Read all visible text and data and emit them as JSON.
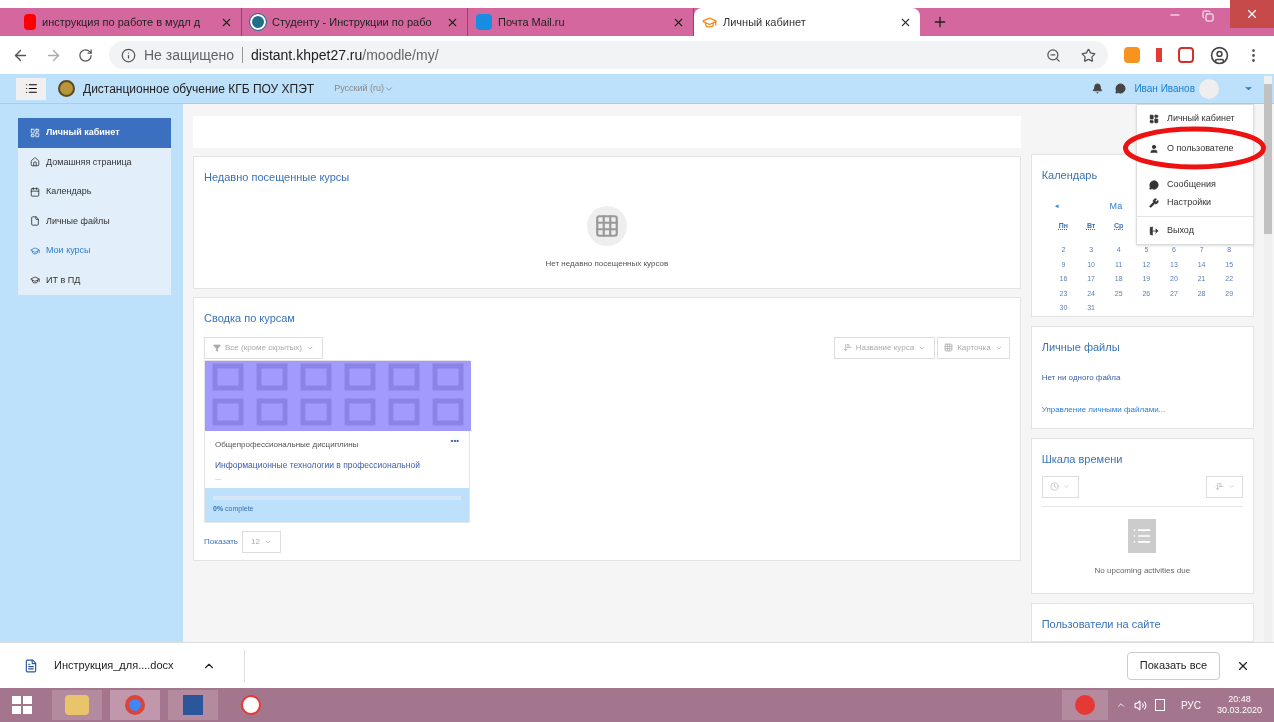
{
  "browser": {
    "tabs": [
      {
        "title": "инструкция по работе в мудл д",
        "selected": false
      },
      {
        "title": "Студенту - Инструкции по рабо",
        "selected": false
      },
      {
        "title": "Почта Mail.ru",
        "selected": false
      },
      {
        "title": "Личный кабинет",
        "selected": true
      }
    ],
    "security": "Не защищено",
    "url_host": "distant.khpet27.ru",
    "url_path": "/moodle/my/"
  },
  "navbar": {
    "site_name": "Дистанционное обучение КГБ ПОУ ХПЭТ",
    "language": "Русский (ru)",
    "user_name": "Иван Иванов"
  },
  "sidebar": {
    "items": [
      {
        "label": "Личный кабинет",
        "selected": true
      },
      {
        "label": "Домашняя страница",
        "selected": false
      },
      {
        "label": "Календарь",
        "selected": false
      },
      {
        "label": "Личные файлы",
        "selected": false
      },
      {
        "label": "Мои курсы",
        "selected": false
      },
      {
        "label": "ИТ в ПД",
        "selected": false
      }
    ]
  },
  "recent": {
    "title": "Недавно посещенные курсы",
    "empty": "Нет недавно посещенных курсов"
  },
  "overview": {
    "title": "Сводка по курсам",
    "filter": "Все (кроме скрытых)",
    "sort": "Название курса",
    "view": "Карточка",
    "course": {
      "category": "Общепрофессиональные дисциплины",
      "name": "Информационные технологии в профессиональной",
      "more": "...",
      "menu": "•••",
      "progress": "0%",
      "progress_suffix": " complete",
      "level": 0
    },
    "show_label": "Показать",
    "show_value": "12"
  },
  "calendar": {
    "title": "Календарь",
    "prev": "◄",
    "month": "Ма",
    "weekdays": [
      "Пн",
      "Вт",
      "Ср"
    ],
    "weeks": [
      [
        "2",
        "3",
        "4",
        "5",
        "6",
        "7",
        "8"
      ],
      [
        "9",
        "10",
        "11",
        "12",
        "13",
        "14",
        "15"
      ],
      [
        "16",
        "17",
        "18",
        "19",
        "20",
        "21",
        "22"
      ],
      [
        "23",
        "24",
        "25",
        "26",
        "27",
        "28",
        "29"
      ],
      [
        "30",
        "31"
      ]
    ]
  },
  "files": {
    "title": "Личные файлы",
    "empty": "Нет ни одного файла",
    "manage": "Управление личными файлами..."
  },
  "timeline": {
    "title": "Шкала времени",
    "empty": "No upcoming activities due"
  },
  "online": {
    "title": "Пользователи на сайте"
  },
  "user_menu": {
    "items": [
      {
        "label": "Личный кабинет",
        "divider_after": false
      },
      {
        "label": "О пользователе",
        "divider_after": false
      },
      {
        "label": "Сообщения",
        "divider_after": false
      },
      {
        "label": "Настройки",
        "divider_after": true
      },
      {
        "label": "Выход",
        "divider_after": false
      }
    ]
  },
  "downloads": {
    "file": "Инструкция_для....docx",
    "show_all": "Показать все"
  },
  "taskbar": {
    "lang": "РУС",
    "time": "20:48",
    "date": "30.03.2020"
  }
}
